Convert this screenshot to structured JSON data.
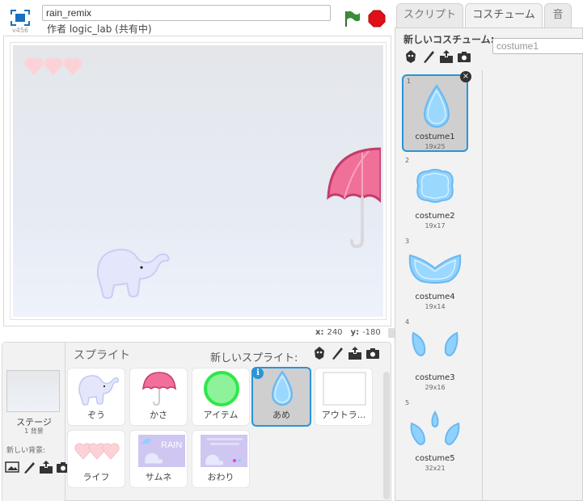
{
  "header": {
    "version": "v456",
    "project_title": "rain_remix",
    "author_line": "作者 logic_lab (共有中)"
  },
  "stage_info": {
    "x_label": "x:",
    "x_value": "240",
    "y_label": "y:",
    "y_value": "-180"
  },
  "sprites_panel": {
    "title": "スプライト",
    "new_sprite_label": "新しいスプライト:",
    "stage_label": "ステージ",
    "stage_sub": "1 背景",
    "new_backdrop_label": "新しい背景:",
    "sprites": [
      {
        "label": "ぞう",
        "icon": "elephant"
      },
      {
        "label": "かさ",
        "icon": "umbrella"
      },
      {
        "label": "アイテム",
        "icon": "green-circle"
      },
      {
        "label": "あめ",
        "icon": "raindrop",
        "selected": true
      },
      {
        "label": "アウトラ...",
        "icon": "outline"
      },
      {
        "label": "ライフ",
        "icon": "hearts"
      },
      {
        "label": "サムネ",
        "icon": "thumbnail"
      },
      {
        "label": "おわり",
        "icon": "ending"
      }
    ],
    "thumb_text": "RAIN"
  },
  "tabs": [
    {
      "label": "スクリプト"
    },
    {
      "label": "コスチューム",
      "active": true
    },
    {
      "label": "音"
    }
  ],
  "costumes": {
    "new_costume_label": "新しいコスチューム:",
    "name_field_value": "costume1",
    "items": [
      {
        "num": "1",
        "name": "costume1",
        "size": "19x25",
        "selected": true
      },
      {
        "num": "2",
        "name": "costume2",
        "size": "19x17"
      },
      {
        "num": "3",
        "name": "costume4",
        "size": "19x14"
      },
      {
        "num": "4",
        "name": "costume3",
        "size": "29x16"
      },
      {
        "num": "5",
        "name": "costume5",
        "size": "32x21"
      }
    ]
  },
  "colors": {
    "selection_blue": "#2a94d6",
    "drop_blue": "#8fd2ff",
    "umbrella_pink": "#ef5f8f",
    "item_green": "#2de84a",
    "stop_red": "#e0101a",
    "flag_green": "#3a8c3a"
  }
}
